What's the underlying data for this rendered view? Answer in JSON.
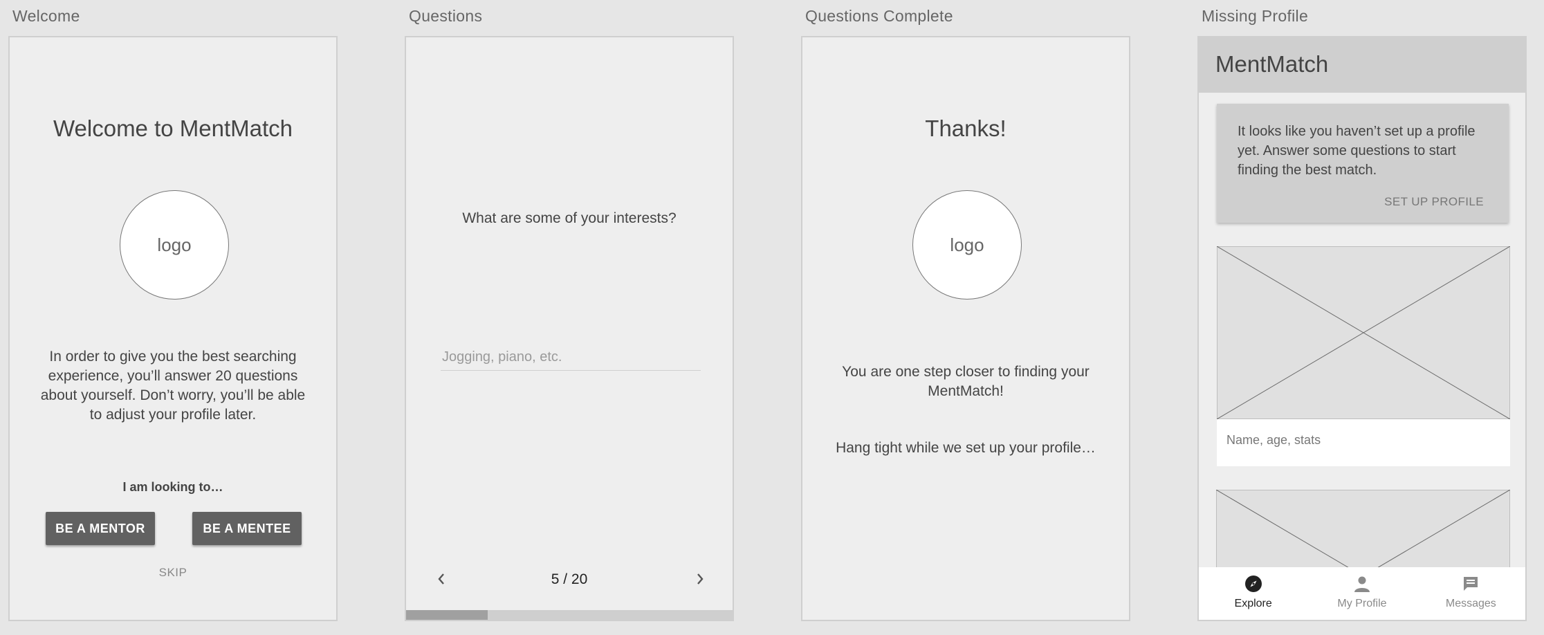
{
  "artboards": {
    "welcome": {
      "title": "Welcome",
      "heading": "Welcome to MentMatch",
      "logo_text": "logo",
      "body": "In order to give you the best searching experience, you’ll answer 20 questions about yourself. Don’t worry, you’ll be able to adjust your profile later.",
      "looking_label": "I am looking to…",
      "mentor_button": "BE A MENTOR",
      "mentee_button": "BE A MENTEE",
      "skip_label": "SKIP"
    },
    "questions": {
      "title": "Questions",
      "question": "What are some of your interests?",
      "answer_placeholder": "Jogging, piano, etc.",
      "answer_value": "",
      "prev_icon": "chevron-left-icon",
      "next_icon": "chevron-right-icon",
      "counter": "5 / 20",
      "progress_fraction": 0.25
    },
    "complete": {
      "title": "Questions Complete",
      "heading": "Thanks!",
      "logo_text": "logo",
      "body": "You are one step closer to finding your MentMatch!",
      "wait_text": "Hang tight while we set up your profile…"
    },
    "missing_profile": {
      "title": "Missing Profile",
      "app_title": "MentMatch",
      "notice_text": "It looks like you haven’t set up a profile yet. Answer some questions to start finding the best match.",
      "notice_action": "SET UP PROFILE",
      "cards": [
        {
          "caption": "Name, age, stats",
          "image_icon": "image-placeholder-icon"
        },
        {
          "caption": "",
          "image_icon": "image-placeholder-icon"
        }
      ],
      "nav": [
        {
          "label": "Explore",
          "icon": "compass-icon",
          "active": true
        },
        {
          "label": "My Profile",
          "icon": "person-icon",
          "active": false
        },
        {
          "label": "Messages",
          "icon": "message-icon",
          "active": false
        }
      ],
      "colors": {
        "nav_active": "#222222",
        "nav_inactive": "#8a8a8a"
      }
    }
  }
}
